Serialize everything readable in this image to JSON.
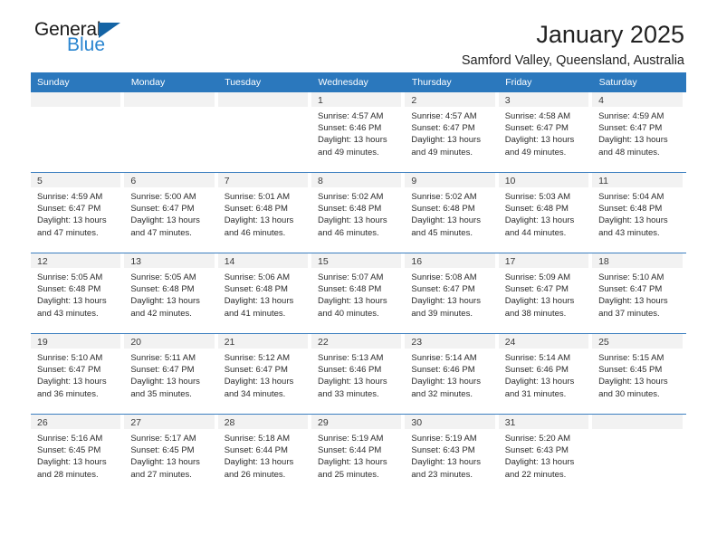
{
  "logo": {
    "word_top": "General",
    "word_bottom": "Blue",
    "triangle_color": "#1464a5",
    "blue_color": "#2a85d0"
  },
  "header": {
    "title": "January 2025",
    "subtitle": "Samford Valley, Queensland, Australia"
  },
  "theme": {
    "header_row_bg": "#2b78bd",
    "day_band_bg": "#f2f2f2",
    "week_divider": "#3c7fc0"
  },
  "weekday_headers": [
    "Sunday",
    "Monday",
    "Tuesday",
    "Wednesday",
    "Thursday",
    "Friday",
    "Saturday"
  ],
  "labels": {
    "sunrise_prefix": "Sunrise:",
    "sunset_prefix": "Sunset:",
    "daylight_prefix": "Daylight:"
  },
  "weeks": [
    [
      {
        "empty": true
      },
      {
        "empty": true
      },
      {
        "empty": true
      },
      {
        "day": "1",
        "sunrise": "Sunrise: 4:57 AM",
        "sunset": "Sunset: 6:46 PM",
        "daylight1": "Daylight: 13 hours",
        "daylight2": "and 49 minutes."
      },
      {
        "day": "2",
        "sunrise": "Sunrise: 4:57 AM",
        "sunset": "Sunset: 6:47 PM",
        "daylight1": "Daylight: 13 hours",
        "daylight2": "and 49 minutes."
      },
      {
        "day": "3",
        "sunrise": "Sunrise: 4:58 AM",
        "sunset": "Sunset: 6:47 PM",
        "daylight1": "Daylight: 13 hours",
        "daylight2": "and 49 minutes."
      },
      {
        "day": "4",
        "sunrise": "Sunrise: 4:59 AM",
        "sunset": "Sunset: 6:47 PM",
        "daylight1": "Daylight: 13 hours",
        "daylight2": "and 48 minutes."
      }
    ],
    [
      {
        "day": "5",
        "sunrise": "Sunrise: 4:59 AM",
        "sunset": "Sunset: 6:47 PM",
        "daylight1": "Daylight: 13 hours",
        "daylight2": "and 47 minutes."
      },
      {
        "day": "6",
        "sunrise": "Sunrise: 5:00 AM",
        "sunset": "Sunset: 6:47 PM",
        "daylight1": "Daylight: 13 hours",
        "daylight2": "and 47 minutes."
      },
      {
        "day": "7",
        "sunrise": "Sunrise: 5:01 AM",
        "sunset": "Sunset: 6:48 PM",
        "daylight1": "Daylight: 13 hours",
        "daylight2": "and 46 minutes."
      },
      {
        "day": "8",
        "sunrise": "Sunrise: 5:02 AM",
        "sunset": "Sunset: 6:48 PM",
        "daylight1": "Daylight: 13 hours",
        "daylight2": "and 46 minutes."
      },
      {
        "day": "9",
        "sunrise": "Sunrise: 5:02 AM",
        "sunset": "Sunset: 6:48 PM",
        "daylight1": "Daylight: 13 hours",
        "daylight2": "and 45 minutes."
      },
      {
        "day": "10",
        "sunrise": "Sunrise: 5:03 AM",
        "sunset": "Sunset: 6:48 PM",
        "daylight1": "Daylight: 13 hours",
        "daylight2": "and 44 minutes."
      },
      {
        "day": "11",
        "sunrise": "Sunrise: 5:04 AM",
        "sunset": "Sunset: 6:48 PM",
        "daylight1": "Daylight: 13 hours",
        "daylight2": "and 43 minutes."
      }
    ],
    [
      {
        "day": "12",
        "sunrise": "Sunrise: 5:05 AM",
        "sunset": "Sunset: 6:48 PM",
        "daylight1": "Daylight: 13 hours",
        "daylight2": "and 43 minutes."
      },
      {
        "day": "13",
        "sunrise": "Sunrise: 5:05 AM",
        "sunset": "Sunset: 6:48 PM",
        "daylight1": "Daylight: 13 hours",
        "daylight2": "and 42 minutes."
      },
      {
        "day": "14",
        "sunrise": "Sunrise: 5:06 AM",
        "sunset": "Sunset: 6:48 PM",
        "daylight1": "Daylight: 13 hours",
        "daylight2": "and 41 minutes."
      },
      {
        "day": "15",
        "sunrise": "Sunrise: 5:07 AM",
        "sunset": "Sunset: 6:48 PM",
        "daylight1": "Daylight: 13 hours",
        "daylight2": "and 40 minutes."
      },
      {
        "day": "16",
        "sunrise": "Sunrise: 5:08 AM",
        "sunset": "Sunset: 6:47 PM",
        "daylight1": "Daylight: 13 hours",
        "daylight2": "and 39 minutes."
      },
      {
        "day": "17",
        "sunrise": "Sunrise: 5:09 AM",
        "sunset": "Sunset: 6:47 PM",
        "daylight1": "Daylight: 13 hours",
        "daylight2": "and 38 minutes."
      },
      {
        "day": "18",
        "sunrise": "Sunrise: 5:10 AM",
        "sunset": "Sunset: 6:47 PM",
        "daylight1": "Daylight: 13 hours",
        "daylight2": "and 37 minutes."
      }
    ],
    [
      {
        "day": "19",
        "sunrise": "Sunrise: 5:10 AM",
        "sunset": "Sunset: 6:47 PM",
        "daylight1": "Daylight: 13 hours",
        "daylight2": "and 36 minutes."
      },
      {
        "day": "20",
        "sunrise": "Sunrise: 5:11 AM",
        "sunset": "Sunset: 6:47 PM",
        "daylight1": "Daylight: 13 hours",
        "daylight2": "and 35 minutes."
      },
      {
        "day": "21",
        "sunrise": "Sunrise: 5:12 AM",
        "sunset": "Sunset: 6:47 PM",
        "daylight1": "Daylight: 13 hours",
        "daylight2": "and 34 minutes."
      },
      {
        "day": "22",
        "sunrise": "Sunrise: 5:13 AM",
        "sunset": "Sunset: 6:46 PM",
        "daylight1": "Daylight: 13 hours",
        "daylight2": "and 33 minutes."
      },
      {
        "day": "23",
        "sunrise": "Sunrise: 5:14 AM",
        "sunset": "Sunset: 6:46 PM",
        "daylight1": "Daylight: 13 hours",
        "daylight2": "and 32 minutes."
      },
      {
        "day": "24",
        "sunrise": "Sunrise: 5:14 AM",
        "sunset": "Sunset: 6:46 PM",
        "daylight1": "Daylight: 13 hours",
        "daylight2": "and 31 minutes."
      },
      {
        "day": "25",
        "sunrise": "Sunrise: 5:15 AM",
        "sunset": "Sunset: 6:45 PM",
        "daylight1": "Daylight: 13 hours",
        "daylight2": "and 30 minutes."
      }
    ],
    [
      {
        "day": "26",
        "sunrise": "Sunrise: 5:16 AM",
        "sunset": "Sunset: 6:45 PM",
        "daylight1": "Daylight: 13 hours",
        "daylight2": "and 28 minutes."
      },
      {
        "day": "27",
        "sunrise": "Sunrise: 5:17 AM",
        "sunset": "Sunset: 6:45 PM",
        "daylight1": "Daylight: 13 hours",
        "daylight2": "and 27 minutes."
      },
      {
        "day": "28",
        "sunrise": "Sunrise: 5:18 AM",
        "sunset": "Sunset: 6:44 PM",
        "daylight1": "Daylight: 13 hours",
        "daylight2": "and 26 minutes."
      },
      {
        "day": "29",
        "sunrise": "Sunrise: 5:19 AM",
        "sunset": "Sunset: 6:44 PM",
        "daylight1": "Daylight: 13 hours",
        "daylight2": "and 25 minutes."
      },
      {
        "day": "30",
        "sunrise": "Sunrise: 5:19 AM",
        "sunset": "Sunset: 6:43 PM",
        "daylight1": "Daylight: 13 hours",
        "daylight2": "and 23 minutes."
      },
      {
        "day": "31",
        "sunrise": "Sunrise: 5:20 AM",
        "sunset": "Sunset: 6:43 PM",
        "daylight1": "Daylight: 13 hours",
        "daylight2": "and 22 minutes."
      },
      {
        "empty": true
      }
    ]
  ]
}
